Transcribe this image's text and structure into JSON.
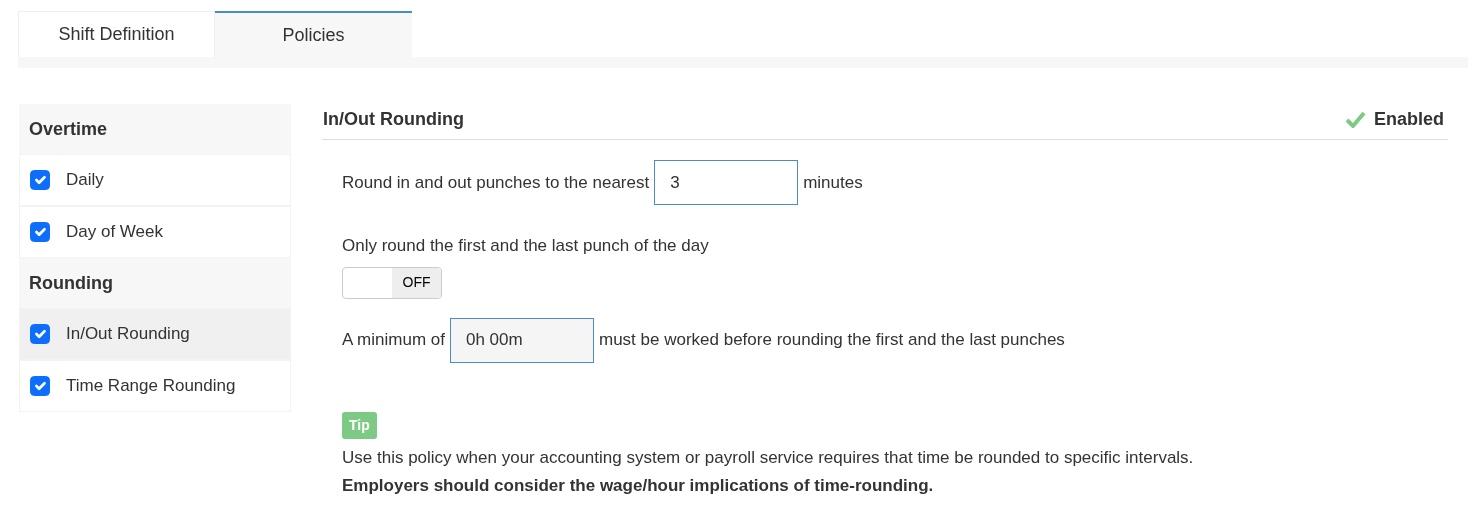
{
  "tabs": [
    {
      "label": "Shift Definition",
      "selected": false
    },
    {
      "label": "Policies",
      "selected": true
    }
  ],
  "sidebar": {
    "groups": [
      {
        "title": "Overtime",
        "items": [
          {
            "label": "Daily",
            "checked": true,
            "selected": false
          },
          {
            "label": "Day of Week",
            "checked": true,
            "selected": false
          }
        ]
      },
      {
        "title": "Rounding",
        "items": [
          {
            "label": "In/Out Rounding",
            "checked": true,
            "selected": true
          },
          {
            "label": "Time Range Rounding",
            "checked": true,
            "selected": false
          }
        ]
      }
    ]
  },
  "panel": {
    "title": "In/Out Rounding",
    "status": {
      "label": "Enabled",
      "enabled": true
    },
    "rounding": {
      "before": "Round in and out punches to the nearest",
      "value": "3",
      "after": "minutes"
    },
    "first_last": {
      "label": "Only round the first and the last punch of the day",
      "toggle": {
        "on": false,
        "label": "OFF"
      }
    },
    "minimum": {
      "before": "A minimum of",
      "value": "0h 00m",
      "disabled": true,
      "after": "must be worked before rounding the first and the last punches"
    },
    "tip": {
      "badge": "Tip",
      "text": "Use this policy when your accounting system or payroll service requires that time be rounded to specific intervals.",
      "note": "Employers should consider the wage/hour implications of time-rounding."
    }
  }
}
